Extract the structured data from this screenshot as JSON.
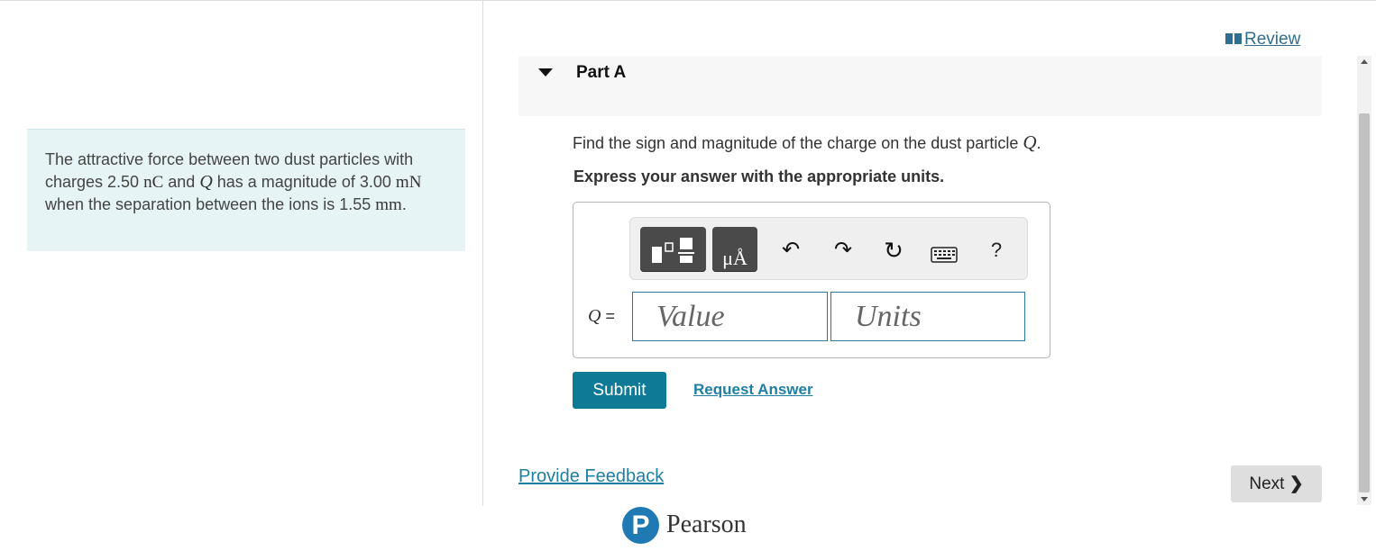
{
  "problem": {
    "pre": "The attractive force between two dust particles with charges 2.50 ",
    "unit1": "nC",
    "mid1": " and ",
    "var_q": "Q",
    "mid2": " has a magnitude of 3.00 ",
    "unit2": "mN",
    "mid3": " when the separation between the ions is 1.55 ",
    "unit3": "mm",
    "end": "."
  },
  "header": {
    "review_label": "Review"
  },
  "part": {
    "title": "Part A"
  },
  "question": {
    "text": "Find the sign and magnitude of the charge on the dust particle ",
    "var": "Q",
    "end": ".",
    "instruction": "Express your answer with the appropriate units."
  },
  "toolbar": {
    "units_button_text": "μÅ",
    "undo_icon": "↶",
    "redo_icon": "↷",
    "reset_icon": "↻",
    "help_label": "?"
  },
  "answer": {
    "label_var": "Q",
    "label_eq": " =",
    "value_placeholder": "Value",
    "units_placeholder": "Units"
  },
  "actions": {
    "submit_label": "Submit",
    "request_label": "Request Answer",
    "feedback_label": "Provide Feedback",
    "next_label": "Next",
    "next_icon": "❯"
  },
  "brand": {
    "logo_letter": "P",
    "name": "Pearson"
  },
  "colors": {
    "accent": "#0f7a96",
    "link": "#1f7fa3",
    "problem_bg": "#e6f4f5"
  }
}
